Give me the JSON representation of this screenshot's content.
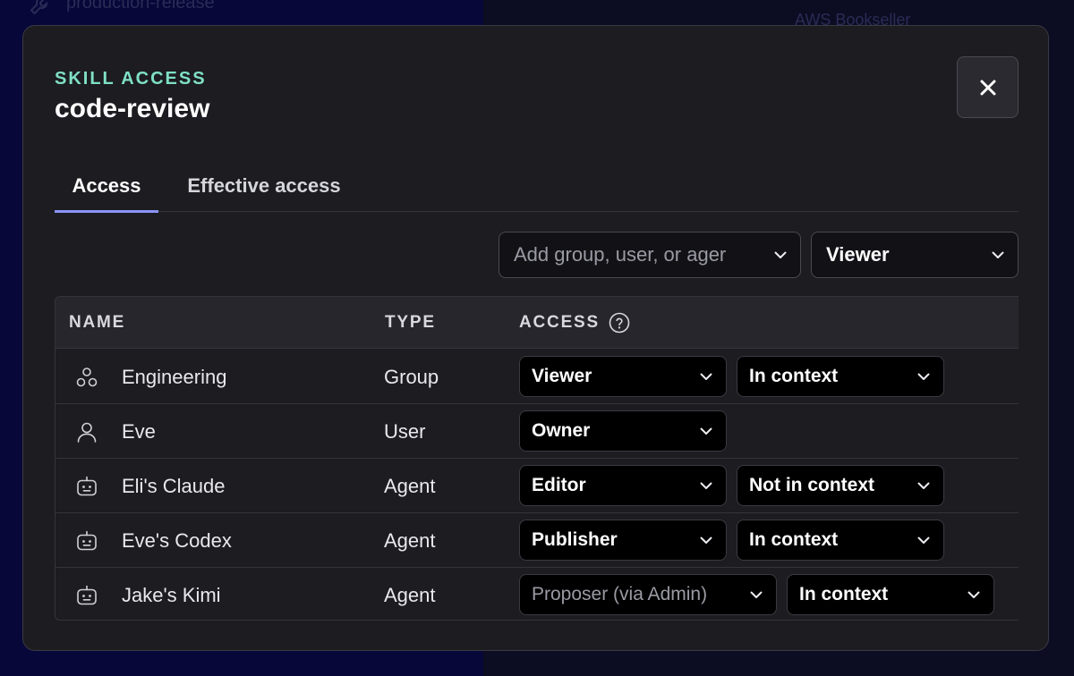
{
  "background": {
    "left_text": "production-release",
    "right_text": "AWS Bookseller"
  },
  "modal": {
    "eyebrow": "SKILL ACCESS",
    "title": "code-review",
    "close_icon": "close-icon",
    "tabs": [
      {
        "label": "Access",
        "active": true
      },
      {
        "label": "Effective access",
        "active": false
      }
    ],
    "add_member": {
      "placeholder": "Add group, user, or ager",
      "role": "Viewer"
    },
    "table": {
      "columns": [
        "NAME",
        "TYPE",
        "ACCESS"
      ],
      "rows": [
        {
          "icon": "group-icon",
          "name": "Engineering",
          "type": "Group",
          "access": "Viewer",
          "context": "In context"
        },
        {
          "icon": "user-icon",
          "name": "Eve",
          "type": "User",
          "access": "Owner",
          "context": null
        },
        {
          "icon": "agent-icon",
          "name": "Eli's Claude",
          "type": "Agent",
          "access": "Editor",
          "context": "Not in context"
        },
        {
          "icon": "agent-icon",
          "name": "Eve's Codex",
          "type": "Agent",
          "access": "Publisher",
          "context": "In context"
        },
        {
          "icon": "agent-icon",
          "name": "Jake's Kimi",
          "type": "Agent",
          "access": "Proposer (via Admin)",
          "access_inherited": true,
          "context": "In context"
        }
      ]
    }
  },
  "colors": {
    "accent_eyebrow": "#7fe0c6",
    "tab_underline": "#8a93f5",
    "modal_bg": "#1c1c21"
  }
}
